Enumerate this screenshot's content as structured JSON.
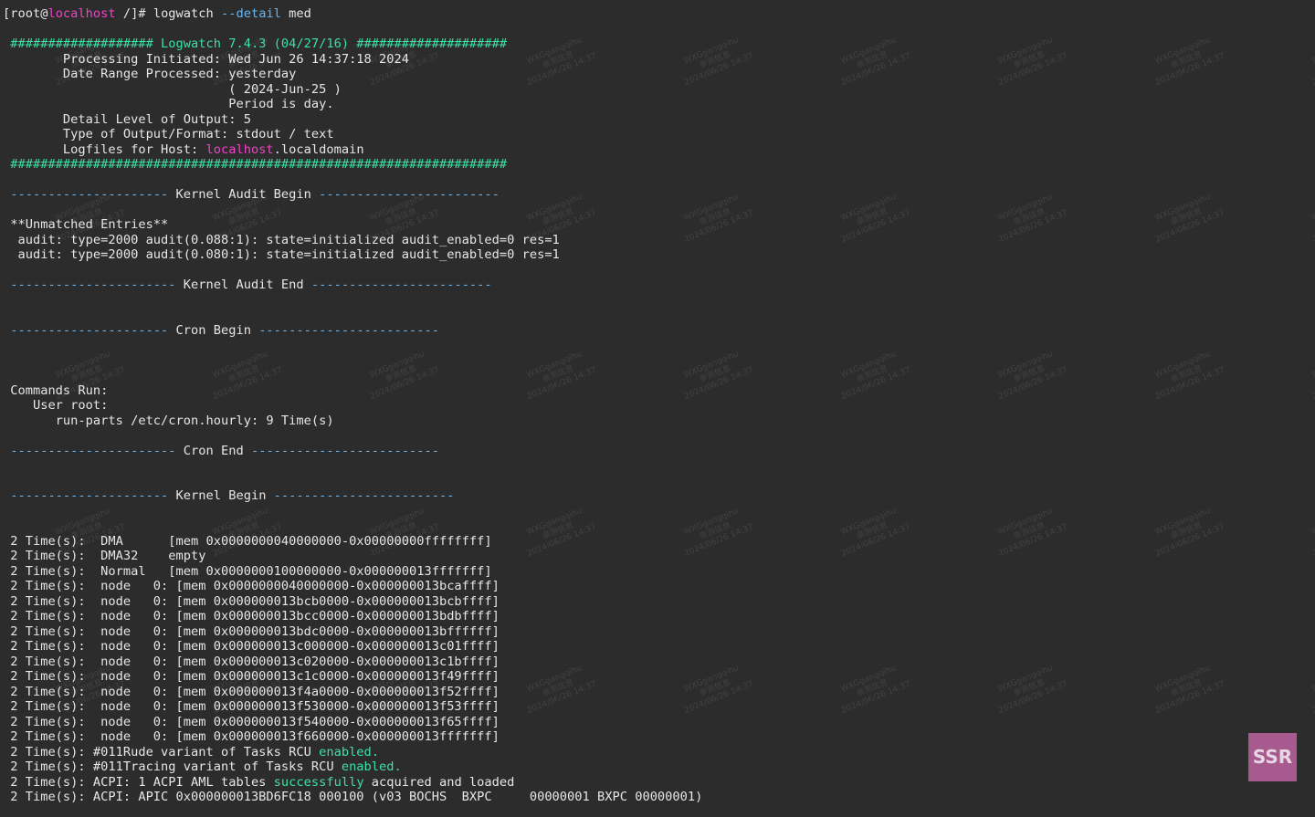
{
  "terminal": {
    "badge": "SSR",
    "watermark": "WXGgangqihu\n亲测信息\n2024/06/26 14:37",
    "lines": [
      [
        {
          "t": "[root@",
          "c": "text"
        },
        {
          "t": "localhost",
          "c": "magenta"
        },
        {
          "t": " /]# logwatch ",
          "c": "text"
        },
        {
          "t": "--detail",
          "c": "blue"
        },
        {
          "t": " med",
          "c": "text"
        }
      ],
      [],
      [
        {
          "t": " ################### Logwatch 7.4.3 (04/27/16) ####################",
          "c": "green"
        }
      ],
      [
        {
          "t": "        Processing Initiated: Wed Jun 26 14:37:18 2024",
          "c": "text"
        }
      ],
      [
        {
          "t": "        Date Range Processed: yesterday",
          "c": "text"
        }
      ],
      [
        {
          "t": "                              ( 2024-Jun-25 )",
          "c": "text"
        }
      ],
      [
        {
          "t": "                              Period is day.",
          "c": "text"
        }
      ],
      [
        {
          "t": "        Detail Level of Output: 5",
          "c": "text"
        }
      ],
      [
        {
          "t": "        Type of Output/Format: stdout / text",
          "c": "text"
        }
      ],
      [
        {
          "t": "        Logfiles for Host: ",
          "c": "text"
        },
        {
          "t": "localhost",
          "c": "magenta"
        },
        {
          "t": ".localdomain",
          "c": "text"
        }
      ],
      [
        {
          "t": " ##################################################################",
          "c": "green"
        }
      ],
      [],
      [
        {
          "t": " --------------------- ",
          "c": "dash"
        },
        {
          "t": "Kernel Audit Begin",
          "c": "text"
        },
        {
          "t": " ------------------------",
          "c": "dash"
        }
      ],
      [],
      [
        {
          "t": " **Unmatched Entries**",
          "c": "text"
        }
      ],
      [
        {
          "t": "  audit: type=2000 audit(0.088:1): state=initialized audit_enabled=0 res=1",
          "c": "text"
        }
      ],
      [
        {
          "t": "  audit: type=2000 audit(0.080:1): state=initialized audit_enabled=0 res=1",
          "c": "text"
        }
      ],
      [],
      [
        {
          "t": " ---------------------- ",
          "c": "dash"
        },
        {
          "t": "Kernel Audit End",
          "c": "text"
        },
        {
          "t": " ------------------------",
          "c": "dash"
        }
      ],
      [],
      [],
      [
        {
          "t": " --------------------- ",
          "c": "dash"
        },
        {
          "t": "Cron Begin",
          "c": "text"
        },
        {
          "t": " ------------------------",
          "c": "dash"
        }
      ],
      [],
      [],
      [],
      [
        {
          "t": " Commands Run:",
          "c": "text"
        }
      ],
      [
        {
          "t": "    User root:",
          "c": "text"
        }
      ],
      [
        {
          "t": "       run-parts /etc/cron.hourly: 9 Time(s)",
          "c": "text"
        }
      ],
      [],
      [
        {
          "t": " ---------------------- ",
          "c": "dash"
        },
        {
          "t": "Cron End",
          "c": "text"
        },
        {
          "t": " -------------------------",
          "c": "dash"
        }
      ],
      [],
      [],
      [
        {
          "t": " --------------------- ",
          "c": "dash"
        },
        {
          "t": "Kernel Begin",
          "c": "text"
        },
        {
          "t": " ------------------------",
          "c": "dash"
        }
      ],
      [],
      [],
      [
        {
          "t": " 2 Time(s):  DMA      [mem 0x0000000040000000-0x00000000ffffffff]",
          "c": "text"
        }
      ],
      [
        {
          "t": " 2 Time(s):  DMA32    empty",
          "c": "text"
        }
      ],
      [
        {
          "t": " 2 Time(s):  Normal   [mem 0x0000000100000000-0x000000013fffffff]",
          "c": "text"
        }
      ],
      [
        {
          "t": " 2 Time(s):  node   0: [mem 0x0000000040000000-0x000000013bcaffff]",
          "c": "text"
        }
      ],
      [
        {
          "t": " 2 Time(s):  node   0: [mem 0x000000013bcb0000-0x000000013bcbffff]",
          "c": "text"
        }
      ],
      [
        {
          "t": " 2 Time(s):  node   0: [mem 0x000000013bcc0000-0x000000013bdbffff]",
          "c": "text"
        }
      ],
      [
        {
          "t": " 2 Time(s):  node   0: [mem 0x000000013bdc0000-0x000000013bffffff]",
          "c": "text"
        }
      ],
      [
        {
          "t": " 2 Time(s):  node   0: [mem 0x000000013c000000-0x000000013c01ffff]",
          "c": "text"
        }
      ],
      [
        {
          "t": " 2 Time(s):  node   0: [mem 0x000000013c020000-0x000000013c1bffff]",
          "c": "text"
        }
      ],
      [
        {
          "t": " 2 Time(s):  node   0: [mem 0x000000013c1c0000-0x000000013f49ffff]",
          "c": "text"
        }
      ],
      [
        {
          "t": " 2 Time(s):  node   0: [mem 0x000000013f4a0000-0x000000013f52ffff]",
          "c": "text"
        }
      ],
      [
        {
          "t": " 2 Time(s):  node   0: [mem 0x000000013f530000-0x000000013f53ffff]",
          "c": "text"
        }
      ],
      [
        {
          "t": " 2 Time(s):  node   0: [mem 0x000000013f540000-0x000000013f65ffff]",
          "c": "text"
        }
      ],
      [
        {
          "t": " 2 Time(s):  node   0: [mem 0x000000013f660000-0x000000013fffffff]",
          "c": "text"
        }
      ],
      [
        {
          "t": " 2 Time(s): #011Rude variant of Tasks RCU ",
          "c": "text"
        },
        {
          "t": "enabled.",
          "c": "green"
        }
      ],
      [
        {
          "t": " 2 Time(s): #011Tracing variant of Tasks RCU ",
          "c": "text"
        },
        {
          "t": "enabled.",
          "c": "green"
        }
      ],
      [
        {
          "t": " 2 Time(s): ACPI: 1 ACPI AML tables ",
          "c": "text"
        },
        {
          "t": "successfully",
          "c": "green"
        },
        {
          "t": " acquired and loaded",
          "c": "text"
        }
      ],
      [
        {
          "t": " 2 Time(s): ACPI: APIC 0x000000013BD6FC18 000100 (v03 BOCHS  BXPC     00000001 BXPC 00000001)",
          "c": "text"
        }
      ]
    ]
  }
}
